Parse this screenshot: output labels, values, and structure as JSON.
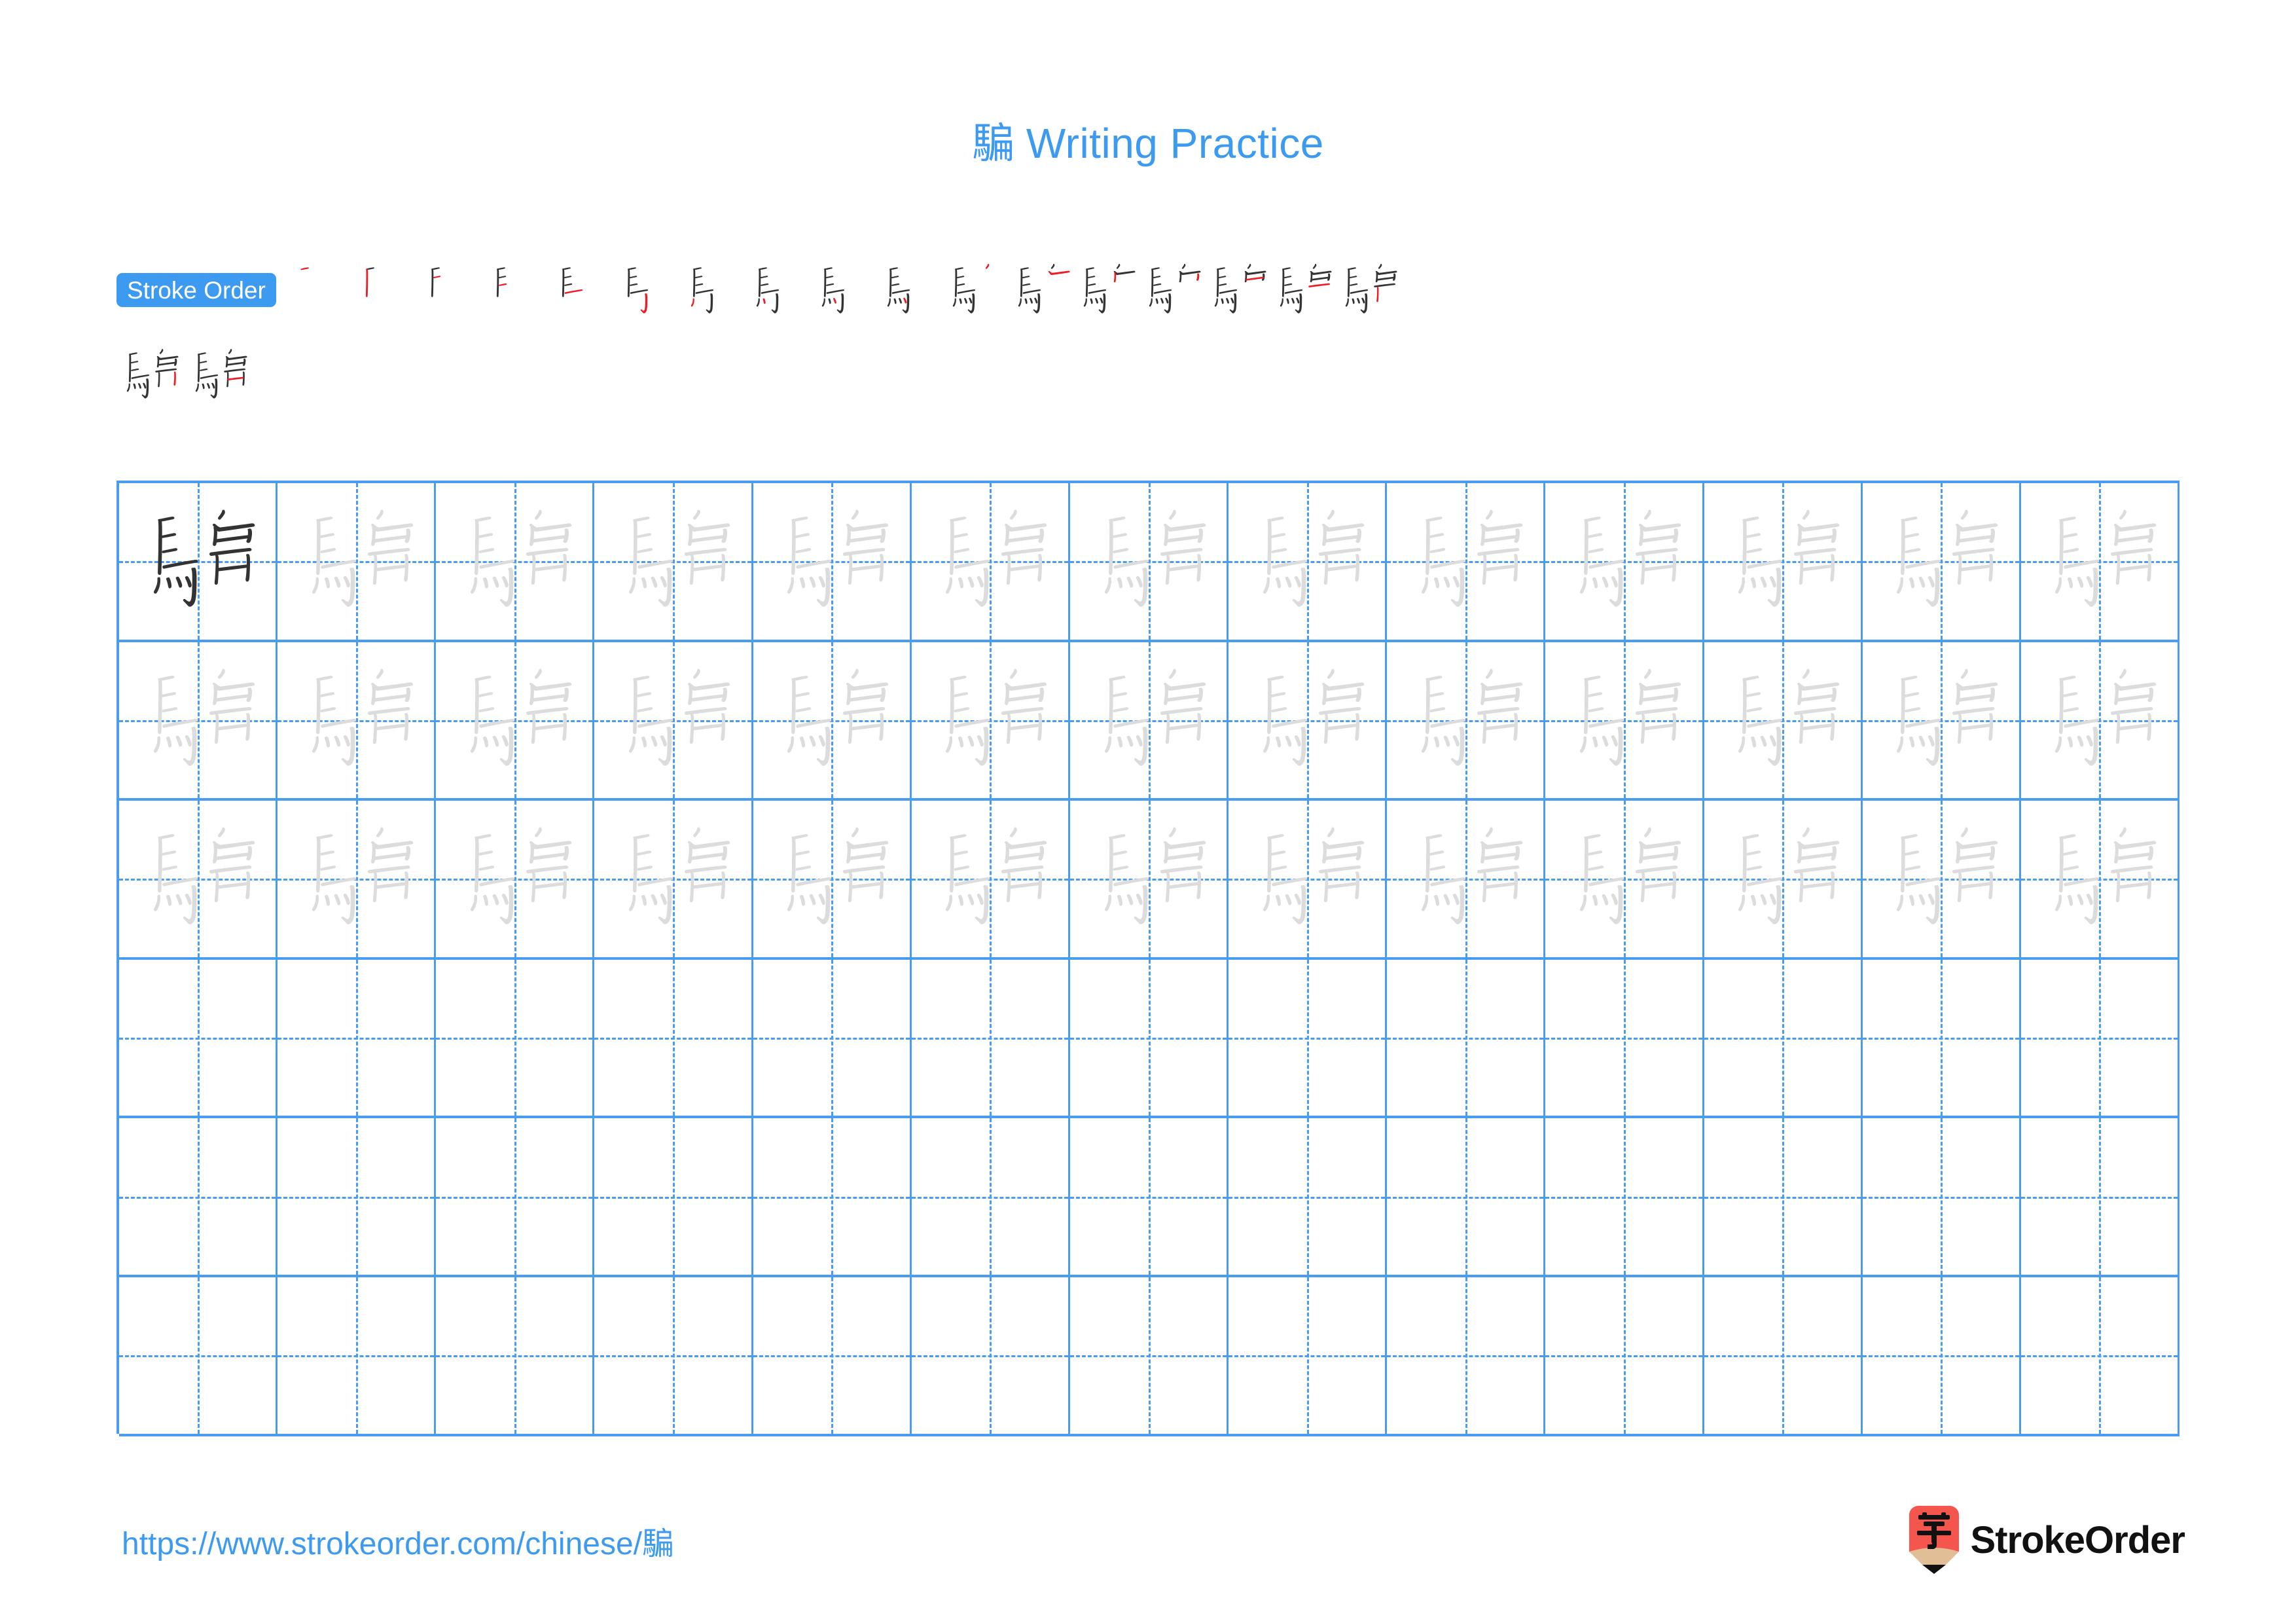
{
  "page": {
    "character": "騙",
    "title_text": "騙 Writing Practice",
    "title_suffix": "Writing Practice"
  },
  "stroke_order": {
    "badge_label": "Stroke Order",
    "total_strokes": 19,
    "accent_color": "#3C9AF0",
    "new_stroke_color": "#EE1C25",
    "done_stroke_color": "#333333",
    "row1_steps": [
      1,
      2,
      3,
      4,
      5,
      6,
      7,
      8,
      9,
      10,
      11,
      12,
      13,
      14,
      15,
      16,
      17
    ],
    "row2_steps": [
      18,
      19
    ]
  },
  "practice_grid": {
    "columns": 13,
    "rows": 6,
    "guide_color": "#4A9CF0",
    "model_char_color": "#333333",
    "trace_char_color": "#DCDCDC",
    "filled_rows": 3,
    "empty_rows": 3,
    "cell_char": "騙"
  },
  "footer": {
    "url": "https://www.strokeorder.com/chinese/騙",
    "brand_name": "StrokeOrder",
    "logo_glyph": "字",
    "logo_body_color": "#F4564E",
    "logo_wood_color": "#E2BE97",
    "logo_tip_color": "#111111"
  }
}
